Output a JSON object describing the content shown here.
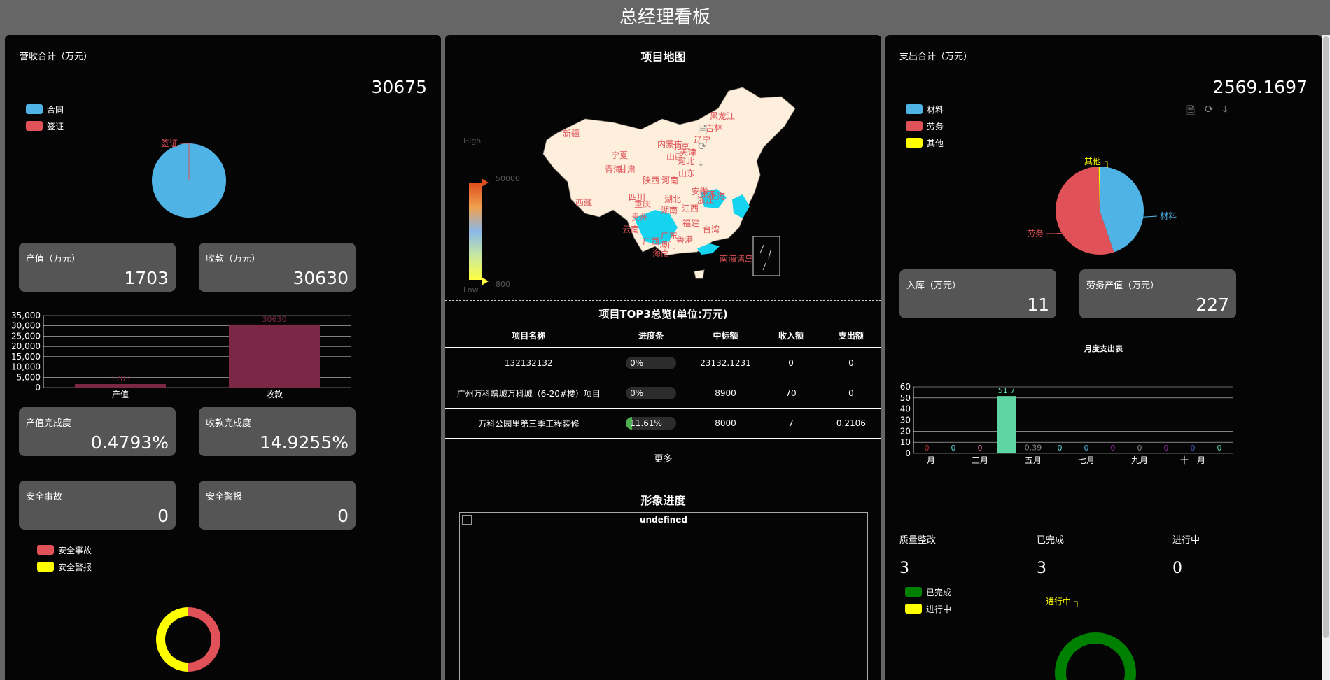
{
  "page": {
    "title": "总经理看板"
  },
  "left": {
    "revenue": {
      "title": "营收合计（万元）",
      "total": "30675",
      "legend": [
        {
          "name": "合同",
          "color": "#4fb3e6"
        },
        {
          "name": "签证",
          "color": "#e05258"
        }
      ],
      "pie_label": "签证"
    },
    "cards1": [
      {
        "label": "产值（万元）",
        "value": "1703"
      },
      {
        "label": "收款（万元）",
        "value": "30630"
      }
    ],
    "cards2": [
      {
        "label": "产值完成度",
        "value": "0.4793%"
      },
      {
        "label": "收款完成度",
        "value": "14.9255%"
      }
    ],
    "cards3": [
      {
        "label": "安全事故",
        "value": "0"
      },
      {
        "label": "安全警报",
        "value": "0"
      }
    ],
    "safety_legend": [
      {
        "name": "安全事故",
        "color": "#e05258"
      },
      {
        "name": "安全警报",
        "color": "#ffff00"
      }
    ]
  },
  "mid": {
    "map_title": "项目地图",
    "visual_map": {
      "high": "High",
      "low": "Low",
      "max": "50000",
      "min": "800"
    },
    "provinces": [
      {
        "name": "黑龙江"
      },
      {
        "name": "吉林"
      },
      {
        "name": "辽宁"
      },
      {
        "name": "新疆"
      },
      {
        "name": "内蒙古"
      },
      {
        "name": "北京"
      },
      {
        "name": "天津"
      },
      {
        "name": "宁夏"
      },
      {
        "name": "山西"
      },
      {
        "name": "河北"
      },
      {
        "name": "青海"
      },
      {
        "name": "甘肃"
      },
      {
        "name": "山东"
      },
      {
        "name": "陕西"
      },
      {
        "name": "河南"
      },
      {
        "name": "西藏"
      },
      {
        "name": "四川"
      },
      {
        "name": "湖北"
      },
      {
        "name": "安徽"
      },
      {
        "name": "江苏"
      },
      {
        "name": "上海"
      },
      {
        "name": "浙江"
      },
      {
        "name": "重庆"
      },
      {
        "name": "湖南"
      },
      {
        "name": "江西"
      },
      {
        "name": "贵州"
      },
      {
        "name": "云南"
      },
      {
        "name": "福建"
      },
      {
        "name": "台湾"
      },
      {
        "name": "广西"
      },
      {
        "name": "广东"
      },
      {
        "name": "香港"
      },
      {
        "name": "澳门"
      },
      {
        "name": "海南"
      },
      {
        "name": "南海诸岛"
      }
    ],
    "top3_title": "项目TOP3总览(单位:万元)",
    "columns": [
      "项目名称",
      "进度条",
      "中标额",
      "收入额",
      "支出额"
    ],
    "rows": [
      {
        "name": "132132132",
        "progress": 0,
        "progress_text": "0%",
        "bid": "23132.1231",
        "income": "0",
        "expense": "0"
      },
      {
        "name": "广州万科增城万科城（6-20#楼）项目",
        "progress": 0,
        "progress_text": "0%",
        "bid": "8900",
        "income": "70",
        "expense": "0"
      },
      {
        "name": "万科公园里第三季工程装修",
        "progress": 11.61,
        "progress_text": "11.61%",
        "bid": "8000",
        "income": "7",
        "expense": "0.2106"
      }
    ],
    "more": "更多",
    "image_title": "形象进度",
    "image_alt": "undefined"
  },
  "right": {
    "expense": {
      "title": "支出合计（万元）",
      "total": "2569.1697",
      "legend": [
        {
          "name": "材料",
          "color": "#4fb3e6"
        },
        {
          "name": "劳务",
          "color": "#e05258"
        },
        {
          "name": "其他",
          "color": "#ffff00"
        }
      ]
    },
    "cards": [
      {
        "label": "入库（万元）",
        "value": "11"
      },
      {
        "label": "劳务产值（万元）",
        "value": "227"
      }
    ],
    "monthly_title": "月度支出表",
    "quality": [
      {
        "label": "质量整改",
        "value": "3"
      },
      {
        "label": "已完成",
        "value": "3"
      },
      {
        "label": "进行中",
        "value": "0"
      }
    ],
    "quality_legend": [
      {
        "name": "已完成",
        "color": "#008000"
      },
      {
        "name": "进行中",
        "color": "#ffff00"
      }
    ],
    "quality_label": "进行中"
  },
  "chart_data": [
    {
      "type": "pie",
      "id": "revenue-pie",
      "labels": [
        "合同",
        "签证"
      ],
      "values": [
        30630,
        45
      ],
      "colors": [
        "#4fb3e6",
        "#e05258"
      ]
    },
    {
      "type": "bar",
      "id": "output-bar",
      "categories": [
        "产值",
        "收款"
      ],
      "values": [
        1703,
        30630
      ],
      "ylim": [
        0,
        35000
      ],
      "yticks": [
        "0",
        "5,000",
        "10,000",
        "15,000",
        "20,000",
        "25,000",
        "30,000",
        "35,000"
      ],
      "color": "#7b2746"
    },
    {
      "type": "pie",
      "id": "expense-pie",
      "labels": [
        "材料",
        "劳务",
        "其他"
      ],
      "values": [
        1150,
        1410,
        9
      ],
      "colors": [
        "#4fb3e6",
        "#e05258",
        "#ffff00"
      ]
    },
    {
      "type": "bar",
      "id": "monthly-bar",
      "categories": [
        "一月",
        "二月",
        "三月",
        "四月",
        "五月",
        "六月",
        "七月",
        "八月",
        "九月",
        "十月",
        "十一月",
        "十二月"
      ],
      "xtick_labels": [
        "一月",
        "三月",
        "五月",
        "七月",
        "九月",
        "十一月"
      ],
      "values": [
        0,
        0,
        0,
        51.7,
        0.39,
        0,
        0,
        0,
        0,
        0,
        0,
        0
      ],
      "value_labels": [
        "0",
        "0",
        "0",
        "51.7",
        "0.39",
        "0",
        "0",
        "0",
        "0",
        "0",
        "0",
        "0"
      ],
      "label_colors": [
        "#c23531",
        "#61dbe3",
        "#d46aa3",
        "#5ed6a3",
        "#888888",
        "#61dbe3",
        "#4fb3e6",
        "#9b27b0",
        "#888888",
        "#9b27b0",
        "#4a5fc1",
        "#5ed6a3"
      ],
      "ylim": [
        0,
        60
      ],
      "yticks": [
        "0",
        "10",
        "20",
        "30",
        "40",
        "50",
        "60"
      ],
      "color": "#5ed6a3"
    },
    {
      "type": "pie",
      "id": "safety-donut",
      "labels": [
        "安全事故",
        "安全警报"
      ],
      "values": [
        1,
        1
      ],
      "colors": [
        "#e05258",
        "#ffff00"
      ]
    },
    {
      "type": "pie",
      "id": "quality-donut",
      "labels": [
        "已完成",
        "进行中"
      ],
      "values": [
        3,
        0
      ],
      "colors": [
        "#008000",
        "#ffff00"
      ]
    }
  ]
}
